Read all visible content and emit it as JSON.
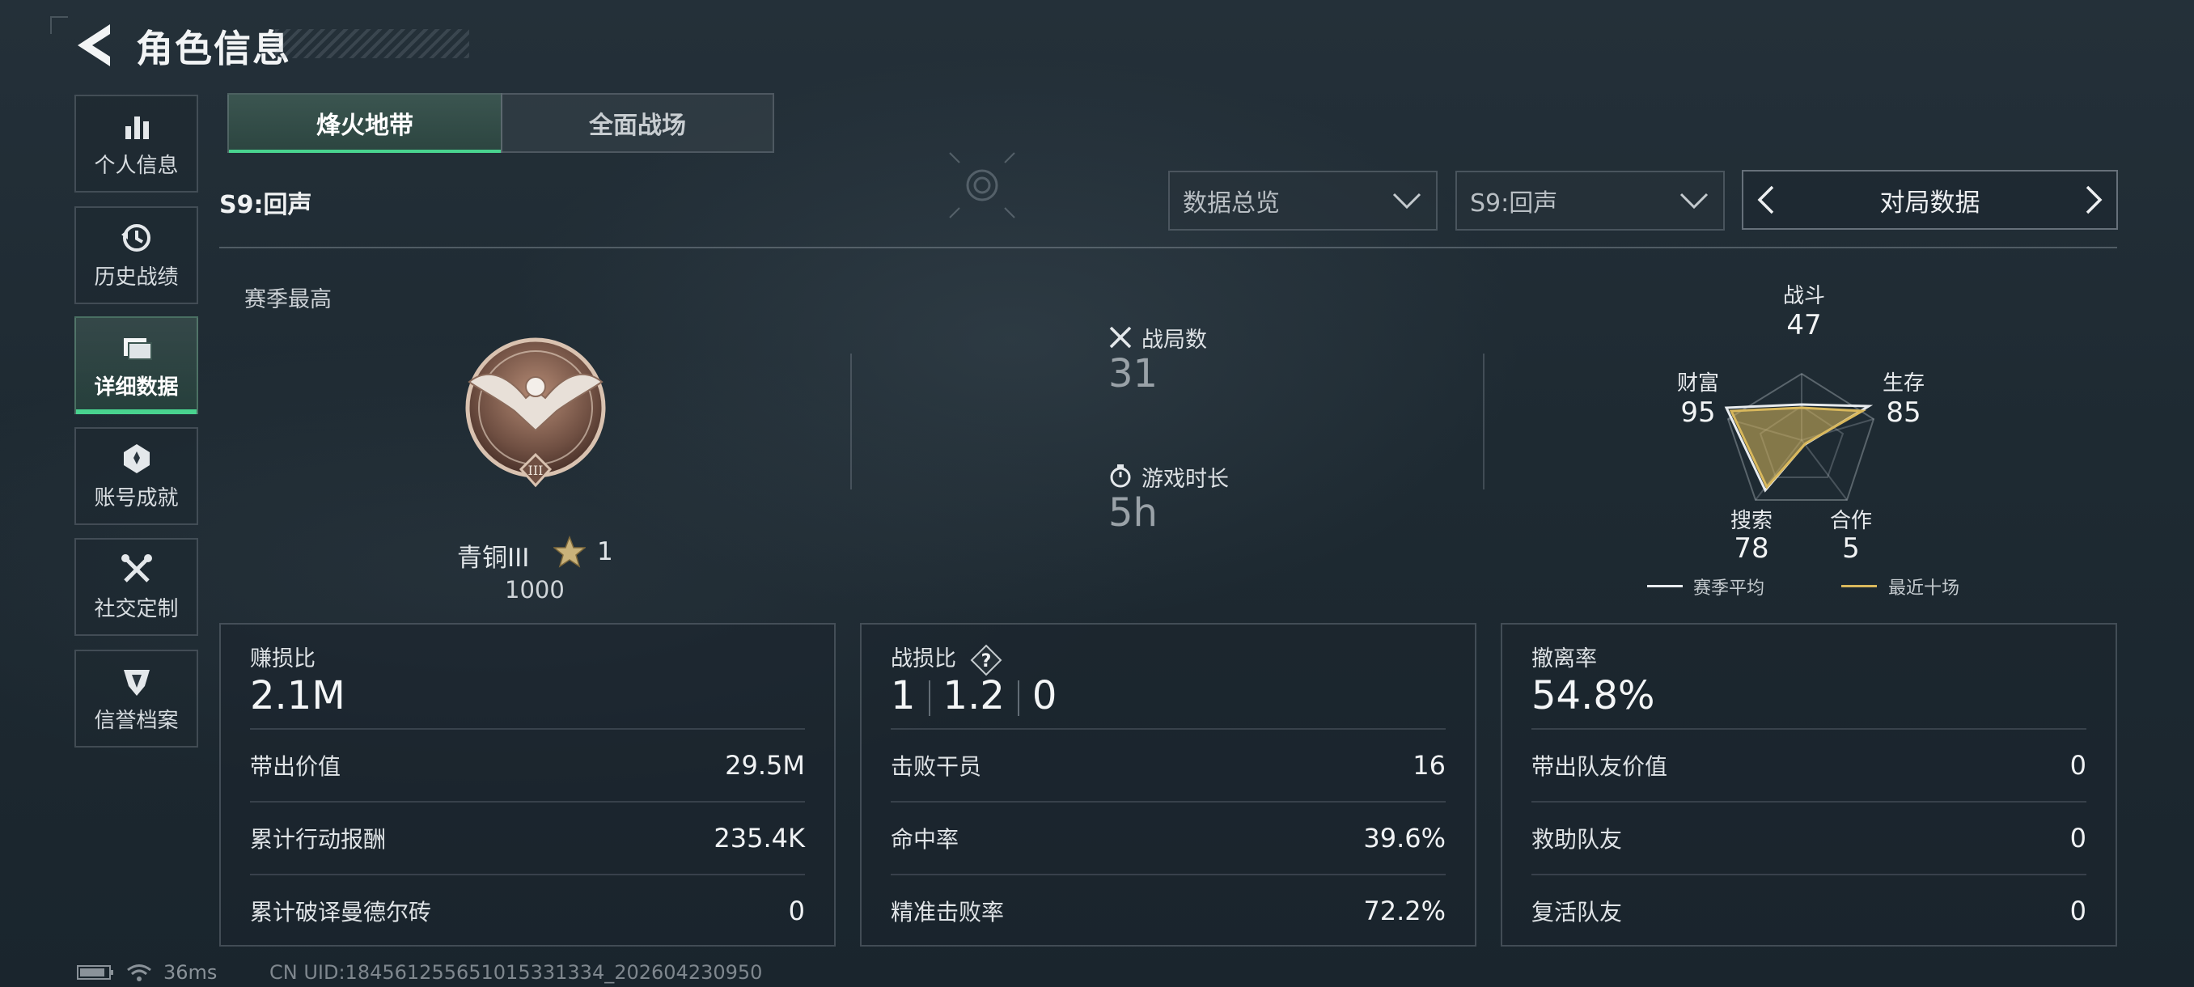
{
  "header": {
    "title": "角色信息"
  },
  "sidebar": {
    "items": [
      {
        "label": "个人信息"
      },
      {
        "label": "历史战绩"
      },
      {
        "label": "详细数据"
      },
      {
        "label": "账号成就"
      },
      {
        "label": "社交定制"
      },
      {
        "label": "信誉档案"
      }
    ]
  },
  "tabs": [
    {
      "label": "烽火地带"
    },
    {
      "label": "全面战场"
    }
  ],
  "season_label": "S9:回声",
  "filters": {
    "overview": "数据总览",
    "season": "S9:回声",
    "pager": "对局数据"
  },
  "rank": {
    "caption": "赛季最高",
    "name": "青铜III",
    "stars": "1",
    "score": "1000",
    "emblem_numeral": "III"
  },
  "match": {
    "battles_label": "战局数",
    "battles_value": "31",
    "duration_label": "游戏时长",
    "duration_value": "5h"
  },
  "radar": {
    "axes": [
      {
        "label": "战斗",
        "value": "47"
      },
      {
        "label": "生存",
        "value": "85"
      },
      {
        "label": "合作",
        "value": "5"
      },
      {
        "label": "搜索",
        "value": "78"
      },
      {
        "label": "财富",
        "value": "95"
      }
    ],
    "legend": [
      {
        "label": "赛季平均",
        "color": "#e8ecef"
      },
      {
        "label": "最近十场",
        "color": "#d9b85c"
      }
    ]
  },
  "panels": {
    "profit": {
      "title": "赚损比",
      "value": "2.1M",
      "rows": [
        {
          "label": "带出价值",
          "value": "29.5M"
        },
        {
          "label": "累计行动报酬",
          "value": "235.4K"
        },
        {
          "label": "累计破译曼德尔砖",
          "value": "0"
        }
      ]
    },
    "kd": {
      "title": "战损比",
      "values": [
        "1",
        "1.2",
        "0"
      ],
      "rows": [
        {
          "label": "击败干员",
          "value": "16"
        },
        {
          "label": "命中率",
          "value": "39.6%"
        },
        {
          "label": "精准击败率",
          "value": "72.2%"
        }
      ]
    },
    "extract": {
      "title": "撤离率",
      "value": "54.8%",
      "rows": [
        {
          "label": "带出队友价值",
          "value": "0"
        },
        {
          "label": "救助队友",
          "value": "0"
        },
        {
          "label": "复活队友",
          "value": "0"
        }
      ]
    }
  },
  "footer": {
    "ping": "36ms",
    "uid": "CN UID:184561255651015331334_202604230950"
  },
  "colors": {
    "accent": "#49d38f",
    "radar_recent": "#d9b85c"
  }
}
